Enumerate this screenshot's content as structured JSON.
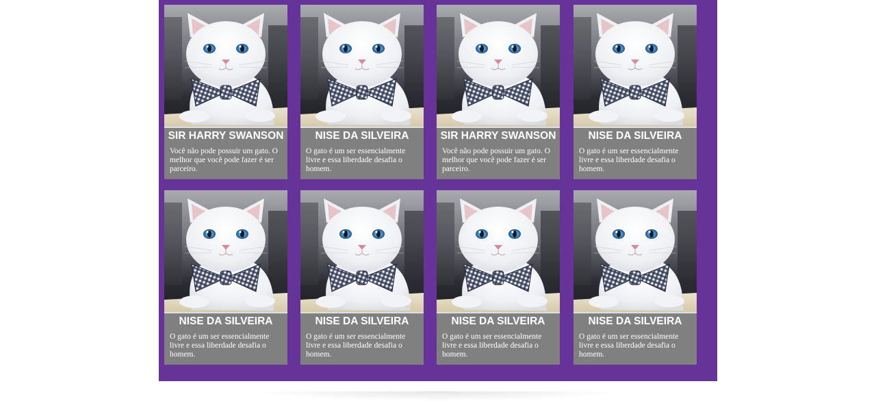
{
  "cards": [
    {
      "title": "SIR HARRY SWANSON",
      "text": "Você não pode possuir um gato. O melhor que você pode fazer é ser parceiro."
    },
    {
      "title": "NISE DA SILVEIRA",
      "text": "O gato é um ser essencialmente livre e essa liberdade desafia o homem."
    },
    {
      "title": "SIR HARRY SWANSON",
      "text": "Você não pode possuir um gato. O melhor que você pode fazer é ser parceiro."
    },
    {
      "title": "NISE DA SILVEIRA",
      "text": "O gato é um ser essencialmente livre e essa liberdade desafia o homem."
    },
    {
      "title": "NISE DA SILVEIRA",
      "text": "O gato é um ser essencialmente livre e essa liberdade desafia o homem."
    },
    {
      "title": "NISE DA SILVEIRA",
      "text": "O gato é um ser essencialmente livre e essa liberdade desafia o homem."
    },
    {
      "title": "NISE DA SILVEIRA",
      "text": "O gato é um ser essencialmente livre e essa liberdade desafia o homem."
    },
    {
      "title": "NISE DA SILVEIRA",
      "text": "O gato é um ser essencialmente livre e essa liberdade desafia o homem."
    }
  ],
  "colors": {
    "background": "#663399",
    "card": "#808080",
    "text": "#ffffff"
  },
  "icons": {
    "photo": "white-cat-with-bow-tie-photo"
  }
}
